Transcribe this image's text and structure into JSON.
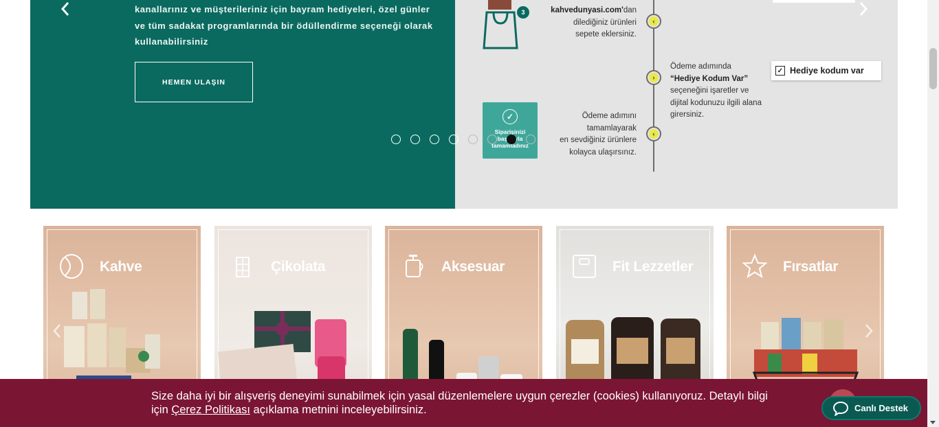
{
  "hero": {
    "line1": "kanallarınız ve müşterileriniz için bayram hediyeleri, özel günler",
    "line2": "ve tüm sadakat programlarında bir ödüllendirme seçeneği olarak",
    "line3": "kullanabilirsiniz",
    "cta_label": "HEMEN ULAŞIN",
    "prev_icon": "chevron-left-icon",
    "next_icon": "chevron-right-icon",
    "slide_count": 8,
    "active_slide": 6
  },
  "infographic": {
    "step1_brand": "kahvedunyasi.com'",
    "step1_suffix": "dan",
    "step1_line2": "dilediğiniz ürünleri",
    "step1_line3": "sepete eklersiniz.",
    "bag_badge": "3",
    "step2_line1": "Ödeme adımında",
    "step2_bold": "“Hediye Kodum Var”",
    "step2_line3": "seçeneğini işaretler ve",
    "step2_line4": "dijital kodunuzu ilgili alana",
    "step2_line5": "girersiniz.",
    "gift_code_label": "Hediye kodum var",
    "step3_line1": "Ödeme adımını",
    "step3_line2": "tamamlayarak",
    "step3_line3": "en sevdiğiniz ürünlere",
    "step3_line4": "kolayca ulaşırsınız.",
    "order_card_line1": "Siparişinizi",
    "order_card_line2": "başarıyla",
    "order_card_line3": "tamamladınız"
  },
  "categories": [
    {
      "title": "Kahve",
      "icon": "coffee-bean-icon"
    },
    {
      "title": "Çikolata",
      "icon": "chocolate-bar-icon"
    },
    {
      "title": "Aksesuar",
      "icon": "french-press-icon"
    },
    {
      "title": "Fit Lezzetler",
      "icon": "scale-icon"
    },
    {
      "title": "Fırsatlar",
      "icon": "star-icon"
    }
  ],
  "cookie": {
    "line1": "Size daha iyi bir alışveriş deneyimi sunabilmek için yasal düzenlemelere uygun çerezler (cookies) kullanıyoruz. Detaylı bilgi",
    "prefix": "için ",
    "link": "Çerez Politikası",
    "suffix": " açıklama metnini inceleyebilirsiniz."
  },
  "support": {
    "label": "Canlı Destek",
    "icon": "chat-bubble-icon"
  },
  "colors": {
    "hero_green": "#0a6a5f",
    "cookie_bg": "#7b1534",
    "support_bg": "#0a5a52",
    "accent_yellow": "#e8e84a"
  }
}
